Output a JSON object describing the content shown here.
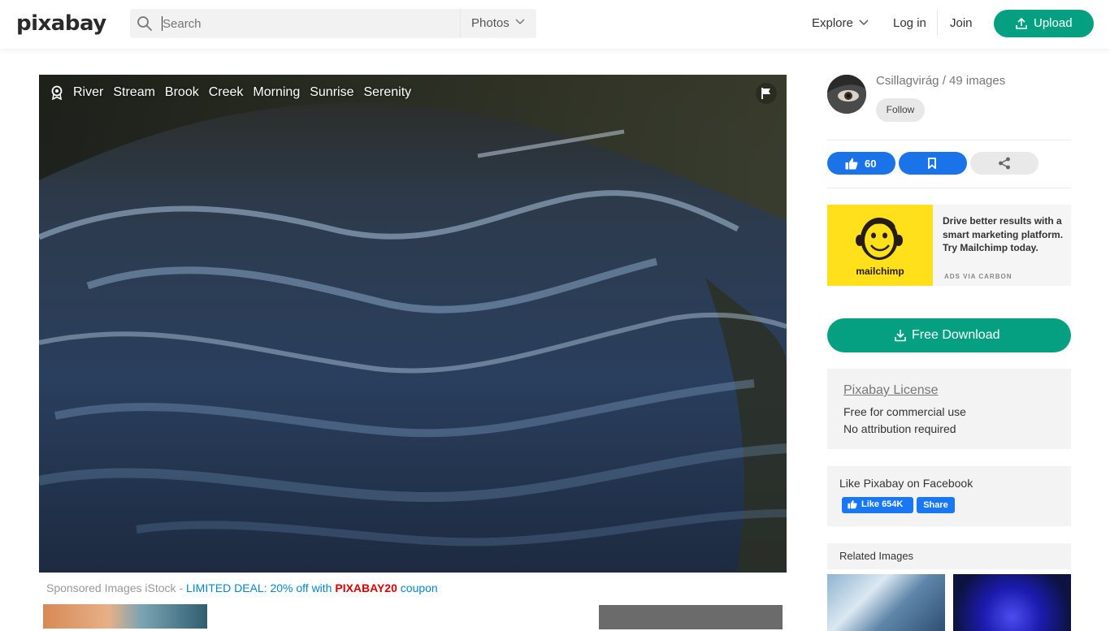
{
  "header": {
    "logo": "pixabay",
    "search_placeholder": "Search",
    "search_type": "Photos",
    "explore": "Explore",
    "login": "Log in",
    "join": "Join",
    "upload": "Upload"
  },
  "photo": {
    "tags": [
      "River",
      "Stream",
      "Brook",
      "Creek",
      "Morning",
      "Sunrise",
      "Serenity"
    ]
  },
  "sponsor": {
    "prefix": "Sponsored Images iStock - ",
    "deal": "LIMITED DEAL: 20% off with ",
    "code": "PIXABAY20",
    "suffix": " coupon"
  },
  "author": {
    "name_line": "Csillagvirág / 49 images",
    "follow": "Follow"
  },
  "actions": {
    "likes": "60"
  },
  "ad": {
    "brand": "mailchimp",
    "text": "Drive better results with a smart marketing platform. Try Mailchimp today.",
    "via": "ADS VIA CARBON"
  },
  "download": {
    "label": "Free Download"
  },
  "license": {
    "title": "Pixabay License",
    "line1": "Free for commercial use",
    "line2": "No attribution required"
  },
  "facebook": {
    "title": "Like Pixabay on Facebook",
    "like": "Like 654K",
    "share": "Share"
  },
  "related": {
    "title": "Related Images"
  },
  "colors": {
    "accent_green": "#05a081",
    "action_blue": "#1a73e8",
    "fb_blue": "#1877f2",
    "coupon_red": "#dd0000",
    "deal_blue": "#0088cc"
  }
}
